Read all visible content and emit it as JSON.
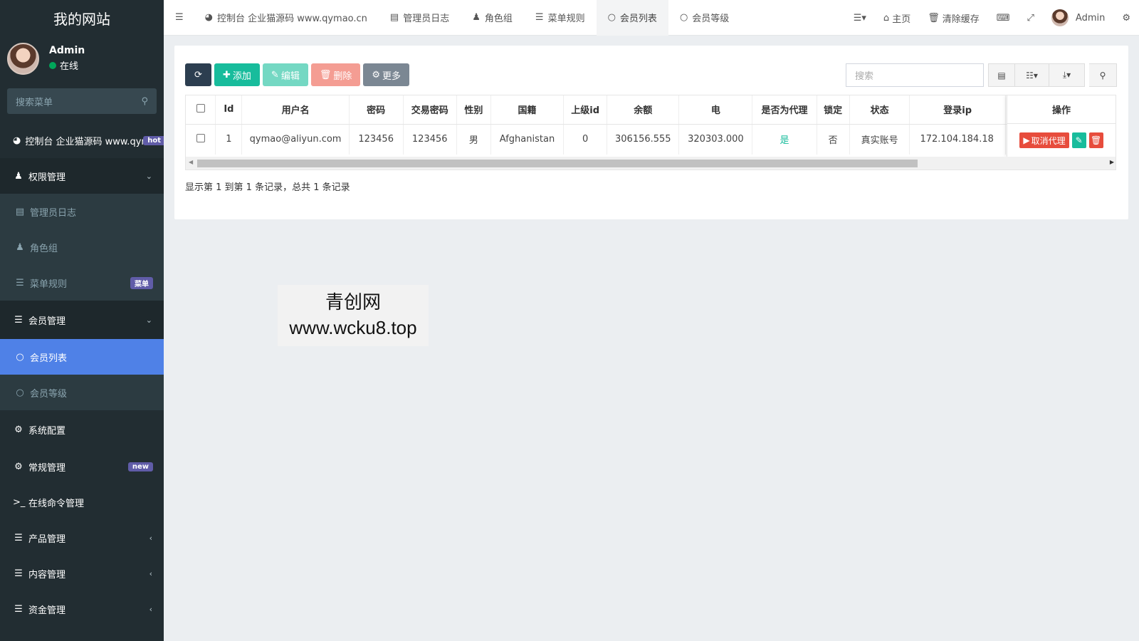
{
  "sidebar": {
    "logo": "我的网站",
    "user": {
      "name": "Admin",
      "status": "在线"
    },
    "search_placeholder": "搜索菜单",
    "items": [
      {
        "label": "控制台 企业猫源码 www.qymao.cn",
        "badge": "hot",
        "icon": "dashboard-icon"
      },
      {
        "label": "权限管理",
        "icon": "users-icon"
      },
      {
        "label": "管理员日志",
        "icon": "list-alt-icon"
      },
      {
        "label": "角色组",
        "icon": "group-icon"
      },
      {
        "label": "菜单规则",
        "badge": "菜单",
        "icon": "bars-icon"
      },
      {
        "label": "会员管理",
        "icon": "list-icon"
      },
      {
        "label": "会员列表",
        "icon": "circle-icon"
      },
      {
        "label": "会员等级",
        "icon": "circle-icon"
      },
      {
        "label": "系统配置",
        "icon": "gear-icon"
      },
      {
        "label": "常规管理",
        "badge": "new",
        "icon": "gears-icon"
      },
      {
        "label": "在线命令管理",
        "icon": "terminal-icon"
      },
      {
        "label": "产品管理",
        "icon": "list-icon"
      },
      {
        "label": "内容管理",
        "icon": "list-icon"
      },
      {
        "label": "资金管理",
        "icon": "list-icon"
      }
    ]
  },
  "topbar": {
    "tabs": [
      {
        "label": "控制台 企业猫源码 www.qymao.cn",
        "icon": "dashboard-icon"
      },
      {
        "label": "管理员日志",
        "icon": "list-alt-icon"
      },
      {
        "label": "角色组",
        "icon": "group-icon"
      },
      {
        "label": "菜单规则",
        "icon": "bars-icon"
      },
      {
        "label": "会员列表",
        "icon": "circle-icon"
      },
      {
        "label": "会员等级",
        "icon": "circle-icon"
      }
    ],
    "home_label": "主页",
    "clear_cache_label": "清除缓存",
    "user_name": "Admin"
  },
  "toolbar": {
    "add_label": "添加",
    "edit_label": "编辑",
    "delete_label": "删除",
    "more_label": "更多",
    "search_placeholder": "搜索"
  },
  "table": {
    "headers": [
      "Id",
      "用户名",
      "密码",
      "交易密码",
      "性别",
      "国籍",
      "上级id",
      "余额",
      "电",
      "是否为代理",
      "锁定",
      "状态",
      "登录ip",
      "操作"
    ],
    "rows": [
      {
        "id": "1",
        "username": "qymao@aliyun.com",
        "password": "123456",
        "trade_password": "123456",
        "gender": "男",
        "country": "Afghanistan",
        "parent_id": "0",
        "balance": "306156.555",
        "electric": "320303.000",
        "is_agent": "是",
        "locked": "否",
        "status": "真实账号",
        "login_ip": "172.104.184.18",
        "cancel_agent_label": "取消代理"
      }
    ]
  },
  "pager_text": "显示第 1 到第 1 条记录，总共 1 条记录",
  "watermark": {
    "line1": "青创网",
    "line2": "www.wcku8.top"
  }
}
